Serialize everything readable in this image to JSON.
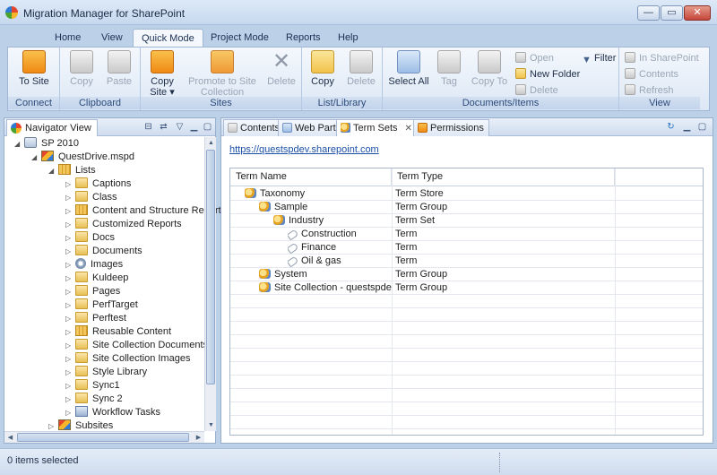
{
  "window": {
    "title": "Migration Manager for SharePoint",
    "min": "—",
    "max": "▭",
    "close": "✕"
  },
  "ribbon": {
    "tabs": [
      "Home",
      "View",
      "Quick Mode",
      "Project Mode",
      "Reports",
      "Help"
    ],
    "active_tab": "Quick Mode",
    "groups": {
      "connect": {
        "label": "Connect",
        "to_site": "To Site"
      },
      "clipboard": {
        "label": "Clipboard",
        "copy": "Copy",
        "paste": "Paste"
      },
      "sites": {
        "label": "Sites",
        "copy_site_1": "Copy",
        "copy_site_2": "Site ▾",
        "promote_1": "Promote to Site",
        "promote_2": "Collection",
        "delete": "Delete"
      },
      "list_library": {
        "label": "List/Library",
        "copy": "Copy",
        "delete": "Delete"
      },
      "documents_items": {
        "label": "Documents/Items",
        "select_all": "Select All",
        "tag": "Tag",
        "copy_to": "Copy To",
        "open": "Open",
        "new_folder": "New Folder",
        "delete": "Delete",
        "filter": "Filter"
      },
      "view": {
        "label": "View",
        "in_sharepoint": "In SharePoint",
        "contents": "Contents",
        "refresh": "Refresh"
      }
    }
  },
  "navigator": {
    "title": "Navigator View",
    "tree": {
      "root": "SP 2010",
      "drive": "QuestDrive.mspd",
      "lists": "Lists",
      "items": [
        {
          "label": "Captions",
          "icon": "folder"
        },
        {
          "label": "Class",
          "icon": "folder"
        },
        {
          "label": "Content and Structure Report",
          "icon": "list"
        },
        {
          "label": "Customized Reports",
          "icon": "folder"
        },
        {
          "label": "Docs",
          "icon": "folder"
        },
        {
          "label": "Documents",
          "icon": "folder"
        },
        {
          "label": "Images",
          "icon": "gear"
        },
        {
          "label": "Kuldeep",
          "icon": "folder"
        },
        {
          "label": "Pages",
          "icon": "folder"
        },
        {
          "label": "PerfTarget",
          "icon": "folder"
        },
        {
          "label": "Perftest",
          "icon": "folder"
        },
        {
          "label": "Reusable Content",
          "icon": "list"
        },
        {
          "label": "Site Collection Documents",
          "icon": "folder"
        },
        {
          "label": "Site Collection Images",
          "icon": "folder"
        },
        {
          "label": "Style Library",
          "icon": "folder"
        },
        {
          "label": "Sync1",
          "icon": "folder"
        },
        {
          "label": "Sync 2",
          "icon": "folder"
        },
        {
          "label": "Workflow Tasks",
          "icon": "workflow"
        }
      ],
      "subsites": "Subsites"
    }
  },
  "content": {
    "tabs": [
      "Contents",
      "Web Parts",
      "Term Sets",
      "Permissions"
    ],
    "active_tab": "Term Sets",
    "url": "https://questspdev.sharepoint.com",
    "grid": {
      "columns": [
        "Term Name",
        "Term Type"
      ],
      "rows": [
        {
          "name": "Taxonomy",
          "type": "Term Store",
          "level": 0,
          "icon": "taxonomy"
        },
        {
          "name": "Sample",
          "type": "Term Group",
          "level": 1,
          "icon": "taxonomy"
        },
        {
          "name": "Industry",
          "type": "Term Set",
          "level": 2,
          "icon": "taxonomy"
        },
        {
          "name": "Construction",
          "type": "Term",
          "level": 3,
          "icon": "tag"
        },
        {
          "name": "Finance",
          "type": "Term",
          "level": 3,
          "icon": "tag"
        },
        {
          "name": "Oil & gas",
          "type": "Term",
          "level": 3,
          "icon": "tag"
        },
        {
          "name": "System",
          "type": "Term Group",
          "level": 1,
          "icon": "taxonomy"
        },
        {
          "name": "Site Collection - questspdev.",
          "type": "Term Group",
          "level": 1,
          "icon": "taxonomy"
        }
      ]
    }
  },
  "status": {
    "text": "0 items selected"
  },
  "colors": {
    "accent": "#2f7bd4",
    "link": "#1a4fa8"
  }
}
